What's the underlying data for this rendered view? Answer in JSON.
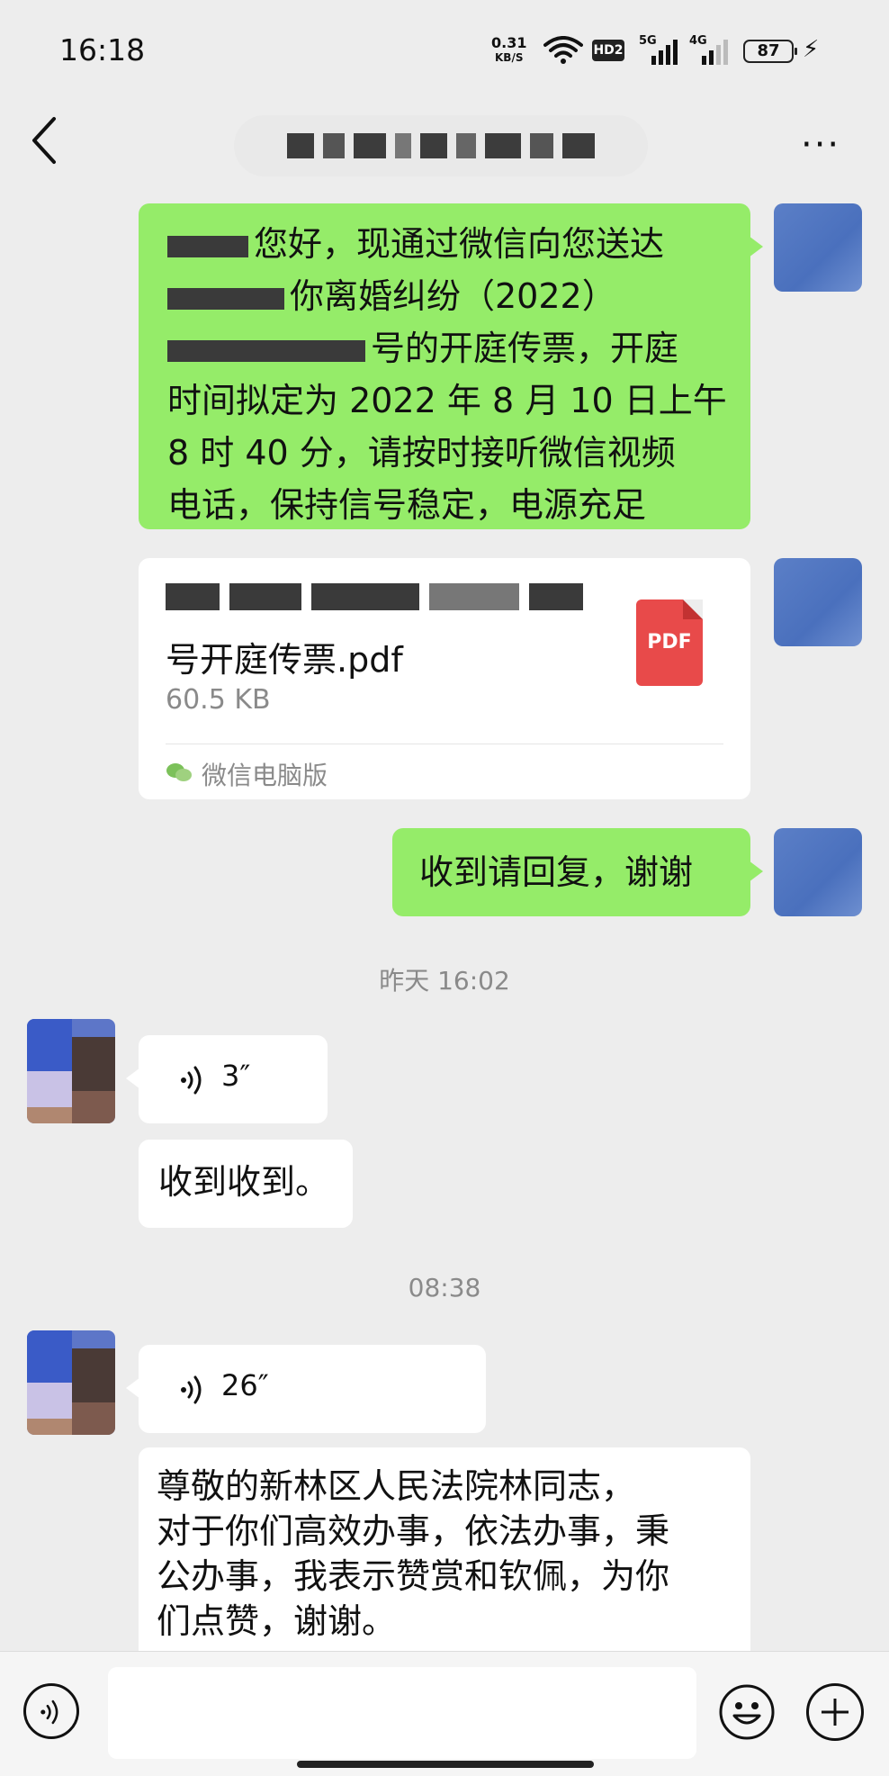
{
  "status_bar": {
    "time": "16:18",
    "net_speed_value": "0.31",
    "net_speed_unit": "KB/S",
    "hd_badge": "HD2",
    "signal1_label": "5G",
    "signal2_label": "4G",
    "battery": "87"
  },
  "header": {
    "back_icon": "chevron-left-icon",
    "more_icon": "more-icon",
    "more_label": "···"
  },
  "messages": {
    "msg1_visible_text": "您好，现通过微信向您送达",
    "msg1_line2": "你离婚纠纷（2022）",
    "msg1_line3": "号的开庭传票，开庭",
    "msg1_line4": "时间拟定为 2022 年 8 月 10 日上午",
    "msg1_line5": "8 时 40 分，请按时接听微信视频",
    "msg1_line6": "电话，保持信号稳定，电源充足",
    "file": {
      "name_line2": "号开庭传票.pdf",
      "size": "60.5 KB",
      "icon_label": "PDF",
      "source": "微信电脑版"
    },
    "msg3": "收到请回复，谢谢",
    "timestamp1": "昨天 16:02",
    "voice1_duration": "3″",
    "reply1": "收到收到。",
    "timestamp2": "08:38",
    "voice2_duration": "26″",
    "reply2_line1": "尊敬的新林区人民法院林同志，",
    "reply2_line2": "对于你们高效办事，依法办事，秉",
    "reply2_line3": "公办事，我表示赞赏和钦佩，为你",
    "reply2_line4": "们点赞，谢谢。"
  },
  "colors": {
    "background": "#ededed",
    "self_bubble": "#95ec69",
    "other_bubble": "#ffffff",
    "pdf_icon": "#e84a4a"
  }
}
